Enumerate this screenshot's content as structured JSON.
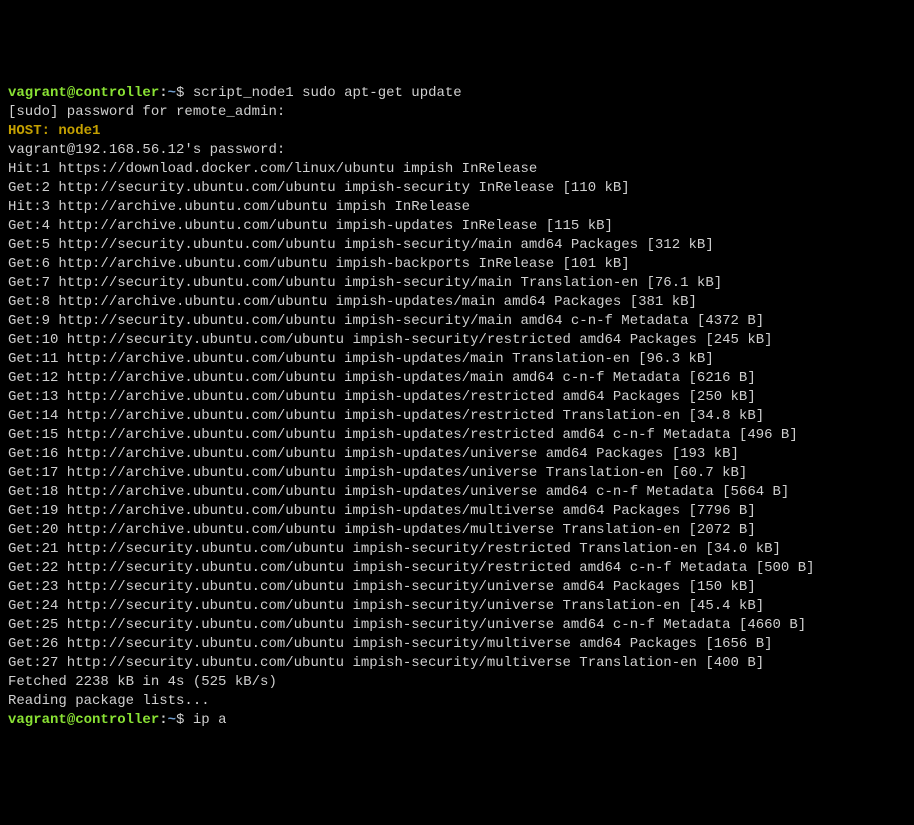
{
  "prompt1": {
    "user": "vagrant",
    "at": "@",
    "host": "controller",
    "colon": ":",
    "path": "~",
    "dollar": "$ ",
    "command": "script_node1 sudo apt-get update"
  },
  "sudo_prompt": "[sudo] password for remote_admin:",
  "blank1": "",
  "host_header": "HOST: node1",
  "ssh_prompt": "vagrant@192.168.56.12's password:",
  "apt_lines": [
    "Hit:1 https://download.docker.com/linux/ubuntu impish InRelease",
    "Get:2 http://security.ubuntu.com/ubuntu impish-security InRelease [110 kB]",
    "Hit:3 http://archive.ubuntu.com/ubuntu impish InRelease",
    "Get:4 http://archive.ubuntu.com/ubuntu impish-updates InRelease [115 kB]",
    "Get:5 http://security.ubuntu.com/ubuntu impish-security/main amd64 Packages [312 kB]",
    "Get:6 http://archive.ubuntu.com/ubuntu impish-backports InRelease [101 kB]",
    "Get:7 http://security.ubuntu.com/ubuntu impish-security/main Translation-en [76.1 kB]",
    "Get:8 http://archive.ubuntu.com/ubuntu impish-updates/main amd64 Packages [381 kB]",
    "Get:9 http://security.ubuntu.com/ubuntu impish-security/main amd64 c-n-f Metadata [4372 B]",
    "Get:10 http://security.ubuntu.com/ubuntu impish-security/restricted amd64 Packages [245 kB]",
    "Get:11 http://archive.ubuntu.com/ubuntu impish-updates/main Translation-en [96.3 kB]",
    "Get:12 http://archive.ubuntu.com/ubuntu impish-updates/main amd64 c-n-f Metadata [6216 B]",
    "Get:13 http://archive.ubuntu.com/ubuntu impish-updates/restricted amd64 Packages [250 kB]",
    "Get:14 http://archive.ubuntu.com/ubuntu impish-updates/restricted Translation-en [34.8 kB]",
    "Get:15 http://archive.ubuntu.com/ubuntu impish-updates/restricted amd64 c-n-f Metadata [496 B]",
    "Get:16 http://archive.ubuntu.com/ubuntu impish-updates/universe amd64 Packages [193 kB]",
    "Get:17 http://archive.ubuntu.com/ubuntu impish-updates/universe Translation-en [60.7 kB]",
    "Get:18 http://archive.ubuntu.com/ubuntu impish-updates/universe amd64 c-n-f Metadata [5664 B]",
    "Get:19 http://archive.ubuntu.com/ubuntu impish-updates/multiverse amd64 Packages [7796 B]",
    "Get:20 http://archive.ubuntu.com/ubuntu impish-updates/multiverse Translation-en [2072 B]",
    "Get:21 http://security.ubuntu.com/ubuntu impish-security/restricted Translation-en [34.0 kB]",
    "Get:22 http://security.ubuntu.com/ubuntu impish-security/restricted amd64 c-n-f Metadata [500 B]",
    "Get:23 http://security.ubuntu.com/ubuntu impish-security/universe amd64 Packages [150 kB]",
    "Get:24 http://security.ubuntu.com/ubuntu impish-security/universe Translation-en [45.4 kB]",
    "Get:25 http://security.ubuntu.com/ubuntu impish-security/universe amd64 c-n-f Metadata [4660 B]",
    "Get:26 http://security.ubuntu.com/ubuntu impish-security/multiverse amd64 Packages [1656 B]",
    "Get:27 http://security.ubuntu.com/ubuntu impish-security/multiverse Translation-en [400 B]"
  ],
  "fetched": "Fetched 2238 kB in 4s (525 kB/s)",
  "reading": "Reading package lists...",
  "prompt2": {
    "user": "vagrant",
    "at": "@",
    "host": "controller",
    "colon": ":",
    "path": "~",
    "dollar": "$ ",
    "command": "ip a"
  }
}
